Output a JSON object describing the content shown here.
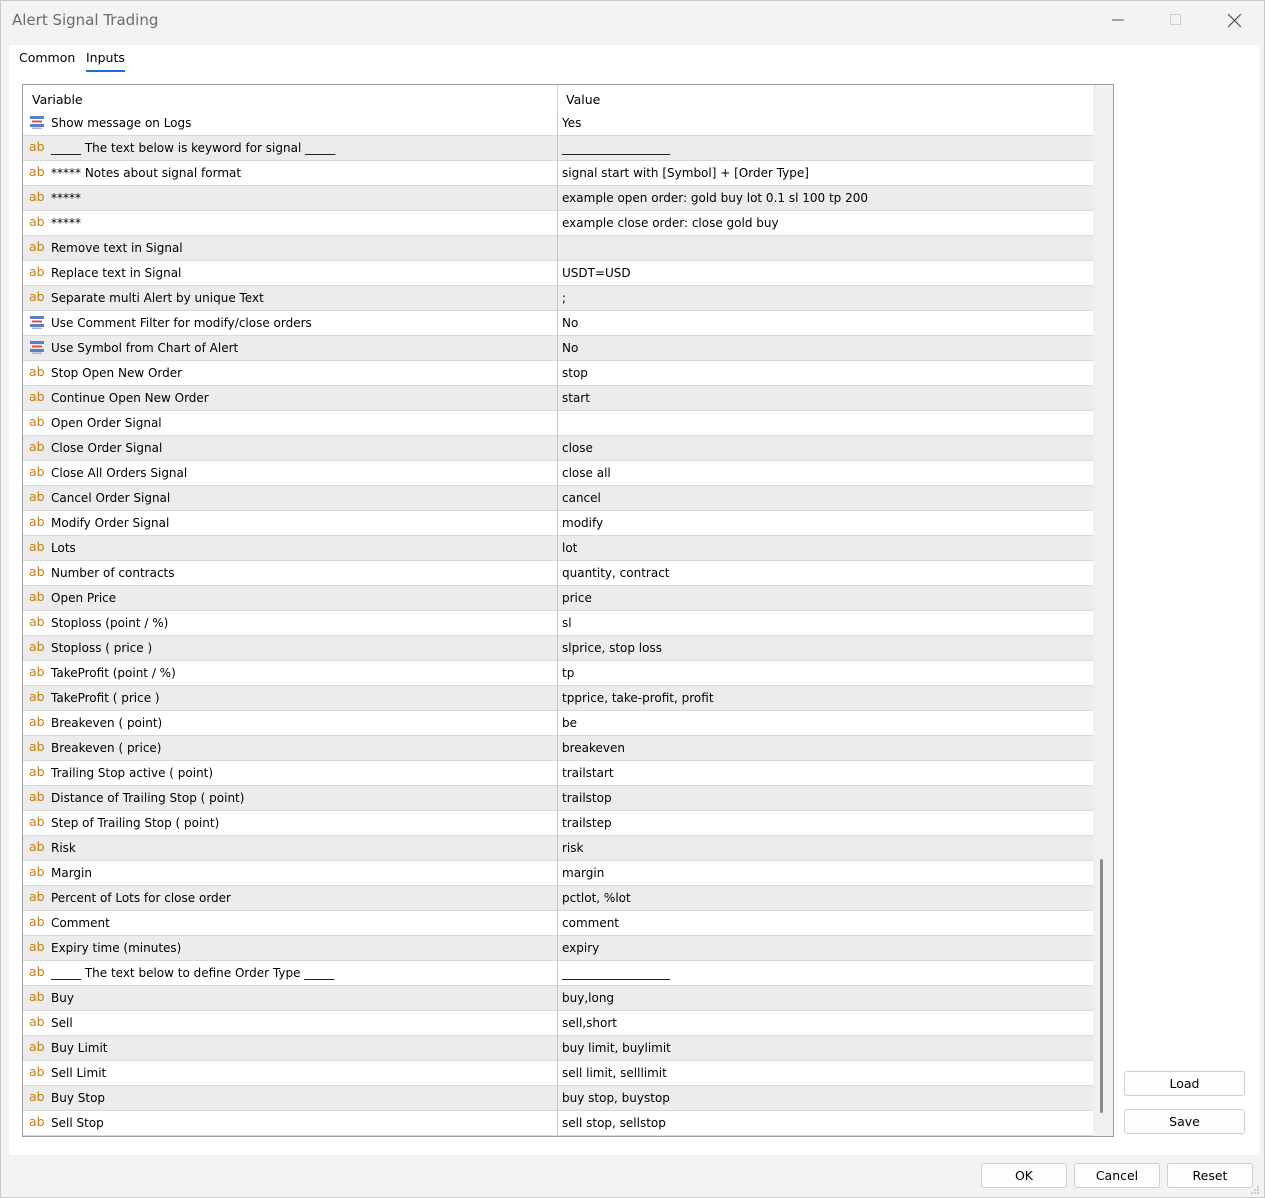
{
  "window": {
    "title": "Alert Signal Trading"
  },
  "tabs": [
    {
      "label": "Common"
    },
    {
      "label": "Inputs",
      "active": true
    }
  ],
  "table": {
    "columns": [
      "Variable",
      "Value"
    ],
    "rows": [
      {
        "icon": "toggle-list-icon",
        "variable": "Show message on Logs",
        "value": "Yes"
      },
      {
        "icon": "ab-text-icon",
        "variable": "_____ The text below is keyword for signal _____",
        "value": "__________________"
      },
      {
        "icon": "ab-text-icon",
        "variable": "***** Notes about signal format",
        "value": "signal start with [Symbol] + [Order Type]"
      },
      {
        "icon": "ab-text-icon",
        "variable": "*****",
        "value": "example open order: gold buy lot 0.1 sl 100 tp 200"
      },
      {
        "icon": "ab-text-icon",
        "variable": "*****",
        "value": "example close order: close gold buy"
      },
      {
        "icon": "ab-text-icon",
        "variable": "Remove text in Signal",
        "value": ""
      },
      {
        "icon": "ab-text-icon",
        "variable": "Replace text in Signal",
        "value": "USDT=USD"
      },
      {
        "icon": "ab-text-icon",
        "variable": "Separate multi Alert by unique Text",
        "value": ";"
      },
      {
        "icon": "toggle-list-icon",
        "variable": "Use Comment Filter for modify/close orders",
        "value": "No"
      },
      {
        "icon": "toggle-list-icon",
        "variable": "Use Symbol from Chart of Alert",
        "value": "No"
      },
      {
        "icon": "ab-text-icon",
        "variable": "Stop Open New Order",
        "value": "stop"
      },
      {
        "icon": "ab-text-icon",
        "variable": "Continue Open New Order",
        "value": "start"
      },
      {
        "icon": "ab-text-icon",
        "variable": "Open Order Signal",
        "value": ""
      },
      {
        "icon": "ab-text-icon",
        "variable": "Close Order Signal",
        "value": "close"
      },
      {
        "icon": "ab-text-icon",
        "variable": "Close All Orders Signal",
        "value": "close all"
      },
      {
        "icon": "ab-text-icon",
        "variable": "Cancel Order Signal",
        "value": "cancel"
      },
      {
        "icon": "ab-text-icon",
        "variable": "Modify Order Signal",
        "value": "modify"
      },
      {
        "icon": "ab-text-icon",
        "variable": "Lots",
        "value": "lot"
      },
      {
        "icon": "ab-text-icon",
        "variable": "Number of contracts",
        "value": "quantity, contract"
      },
      {
        "icon": "ab-text-icon",
        "variable": "Open Price",
        "value": "price"
      },
      {
        "icon": "ab-text-icon",
        "variable": "Stoploss (point / %)",
        "value": "sl"
      },
      {
        "icon": "ab-text-icon",
        "variable": "Stoploss ( price )",
        "value": "slprice, stop loss"
      },
      {
        "icon": "ab-text-icon",
        "variable": "TakeProfit (point / %)",
        "value": "tp"
      },
      {
        "icon": "ab-text-icon",
        "variable": "TakeProfit ( price )",
        "value": "tpprice, take-profit, profit"
      },
      {
        "icon": "ab-text-icon",
        "variable": "Breakeven ( point)",
        "value": "be"
      },
      {
        "icon": "ab-text-icon",
        "variable": "Breakeven ( price)",
        "value": "breakeven"
      },
      {
        "icon": "ab-text-icon",
        "variable": "Trailing Stop active ( point)",
        "value": "trailstart"
      },
      {
        "icon": "ab-text-icon",
        "variable": "Distance of Trailing Stop ( point)",
        "value": "trailstop"
      },
      {
        "icon": "ab-text-icon",
        "variable": "Step of Trailing Stop ( point)",
        "value": "trailstep"
      },
      {
        "icon": "ab-text-icon",
        "variable": "Risk",
        "value": "risk"
      },
      {
        "icon": "ab-text-icon",
        "variable": "Margin",
        "value": "margin"
      },
      {
        "icon": "ab-text-icon",
        "variable": "Percent of Lots for close order",
        "value": "pctlot, %lot"
      },
      {
        "icon": "ab-text-icon",
        "variable": "Comment",
        "value": "comment"
      },
      {
        "icon": "ab-text-icon",
        "variable": "Expiry time (minutes)",
        "value": "expiry"
      },
      {
        "icon": "ab-text-icon",
        "variable": "_____ The text below to define Order Type _____",
        "value": "__________________"
      },
      {
        "icon": "ab-text-icon",
        "variable": "Buy",
        "value": "buy,long"
      },
      {
        "icon": "ab-text-icon",
        "variable": "Sell",
        "value": "sell,short"
      },
      {
        "icon": "ab-text-icon",
        "variable": "Buy Limit",
        "value": "buy limit, buylimit"
      },
      {
        "icon": "ab-text-icon",
        "variable": "Sell Limit",
        "value": "sell limit, selllimit"
      },
      {
        "icon": "ab-text-icon",
        "variable": "Buy Stop",
        "value": "buy stop, buystop"
      },
      {
        "icon": "ab-text-icon",
        "variable": "Sell Stop",
        "value": "sell stop, sellstop"
      }
    ]
  },
  "side_buttons": {
    "load": "Load",
    "save": "Save"
  },
  "footer_buttons": {
    "ok": "OK",
    "cancel": "Cancel",
    "reset": "Reset"
  },
  "ab_glyph": "ab",
  "colors": {
    "accent": "#1a6fd1",
    "ab_icon": "#c77e0a",
    "row_alt": "#ececec"
  }
}
